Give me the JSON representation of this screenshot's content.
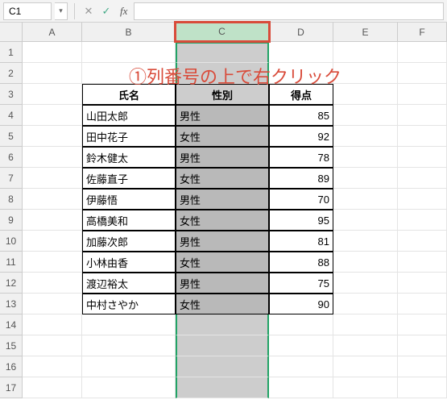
{
  "namebox": {
    "cell_ref": "C1"
  },
  "columns": [
    "A",
    "B",
    "C",
    "D",
    "E",
    "F"
  ],
  "selected_column": "C",
  "annotation": "①列番号の上で右クリック",
  "table": {
    "headers": {
      "name": "氏名",
      "gender": "性別",
      "score": "得点"
    },
    "rows": [
      {
        "name": "山田太郎",
        "gender": "男性",
        "score": 85
      },
      {
        "name": "田中花子",
        "gender": "女性",
        "score": 92
      },
      {
        "name": "鈴木健太",
        "gender": "男性",
        "score": 78
      },
      {
        "name": "佐藤直子",
        "gender": "女性",
        "score": 89
      },
      {
        "name": "伊藤悟",
        "gender": "男性",
        "score": 70
      },
      {
        "name": "高橋美和",
        "gender": "女性",
        "score": 95
      },
      {
        "name": "加藤次郎",
        "gender": "男性",
        "score": 81
      },
      {
        "name": "小林由香",
        "gender": "女性",
        "score": 88
      },
      {
        "name": "渡辺裕太",
        "gender": "男性",
        "score": 75
      },
      {
        "name": "中村さやか",
        "gender": "女性",
        "score": 90
      }
    ]
  },
  "row_count": 17
}
